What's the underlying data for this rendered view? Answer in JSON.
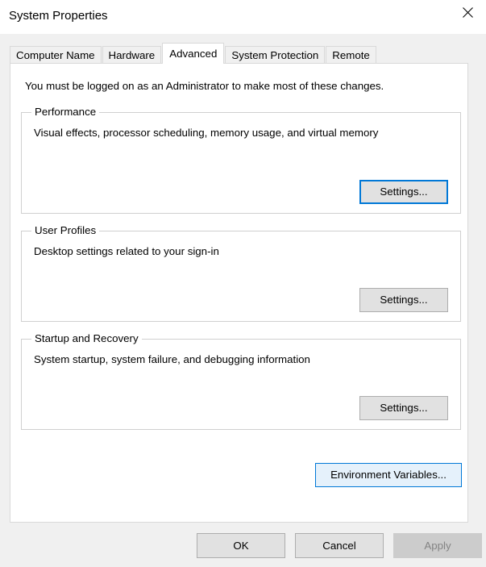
{
  "window": {
    "title": "System Properties",
    "close_icon": "close-icon"
  },
  "tabs": [
    {
      "label": "Computer Name",
      "active": false
    },
    {
      "label": "Hardware",
      "active": false
    },
    {
      "label": "Advanced",
      "active": true
    },
    {
      "label": "System Protection",
      "active": false
    },
    {
      "label": "Remote",
      "active": false
    }
  ],
  "panel": {
    "admin_note": "You must be logged on as an Administrator to make most of these changes.",
    "groups": [
      {
        "legend": "Performance",
        "description": "Visual effects, processor scheduling, memory usage, and virtual memory",
        "button_label": "Settings..."
      },
      {
        "legend": "User Profiles",
        "description": "Desktop settings related to your sign-in",
        "button_label": "Settings..."
      },
      {
        "legend": "Startup and Recovery",
        "description": "System startup, system failure, and debugging information",
        "button_label": "Settings..."
      }
    ],
    "environment_variables_label": "Environment Variables..."
  },
  "footer": {
    "ok_label": "OK",
    "cancel_label": "Cancel",
    "apply_label": "Apply"
  },
  "colors": {
    "accent": "#0078d7",
    "hover_fill": "#e5f1fb",
    "button_face": "#e1e1e1",
    "window_body": "#f0f0f0",
    "disabled_text": "#838383"
  }
}
